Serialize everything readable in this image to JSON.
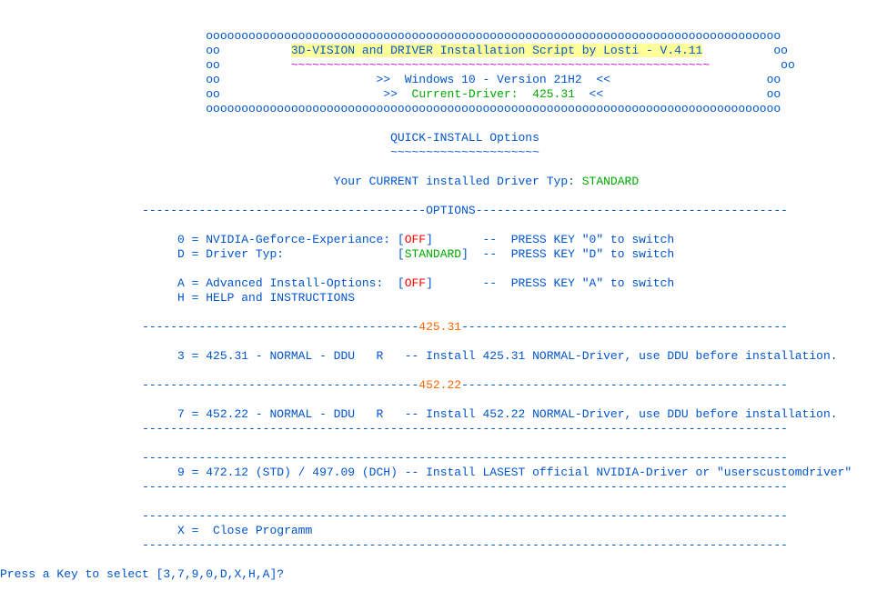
{
  "border": {
    "top": "ooooooooooooooooooooooooooooooooooooooooooooooooooooooooooooooooooooooooooooooooo",
    "side": "oo",
    "bottom": "ooooooooooooooooooooooooooooooooooooooooooooooooooooooooooooooooooooooooooooooooo"
  },
  "header": {
    "title": "3D-VISION and DRIVER Installation Script by Losti - V.4.11",
    "tilde": "~~~~~~~~~~~~~~~~~~~~~~~~~~~~~~~~~~~~~~~~~~~~~~~~~~~~~~~~~~~",
    "win_line_pre": ">>  Windows 10 - Version 21H2  <<",
    "cur_pre": ">>  ",
    "cur_label": "Current-Driver:  425.31",
    "cur_post": "  <<"
  },
  "quick": {
    "title": "QUICK-INSTALL Options",
    "tilde": "~~~~~~~~~~~~~~~~~~~~~",
    "cur_pre": "Your CURRENT installed Driver Typ: ",
    "cur_val": "STANDARD"
  },
  "options_divider": {
    "pre": "----------------------------------------",
    "mid": "OPTIONS",
    "post": "--------------------------------------------"
  },
  "opts": {
    "o0_pre": "0 = NVIDIA-Geforce-Experiance: [",
    "o0_val": "OFF",
    "o0_post": "]       --  PRESS KEY \"0\" to switch",
    "d_pre": "D = Driver Typ:                [",
    "d_val": "STANDARD",
    "d_post": "]  --  PRESS KEY \"D\" to switch",
    "a_pre": "A = Advanced Install-Options:  [",
    "a_val": "OFF",
    "a_post": "]       --  PRESS KEY \"A\" to switch",
    "h": "H = HELP and INSTRUCTIONS"
  },
  "div425": {
    "pre": "---------------------------------------",
    "mid": "425.31",
    "post": "----------------------------------------------"
  },
  "line3": "3 = 425.31 - NORMAL - DDU   R   -- Install 425.31 NORMAL-Driver, use DDU before installation.",
  "div452": {
    "pre": "---------------------------------------",
    "mid": "452.22",
    "post": "----------------------------------------------"
  },
  "line7": "7 = 452.22 - NORMAL - DDU   R   -- Install 452.22 NORMAL-Driver, use DDU before installation.",
  "dash91": "-------------------------------------------------------------------------------------------",
  "line9": "9 = 472.12 (STD) / 497.09 (DCH) -- Install LASEST official NVIDIA-Driver or \"userscustomdriver\"",
  "lineX": "X =  Close Programm",
  "prompt": "Press a Key to select [3,7,9,0,D,X,H,A]?"
}
